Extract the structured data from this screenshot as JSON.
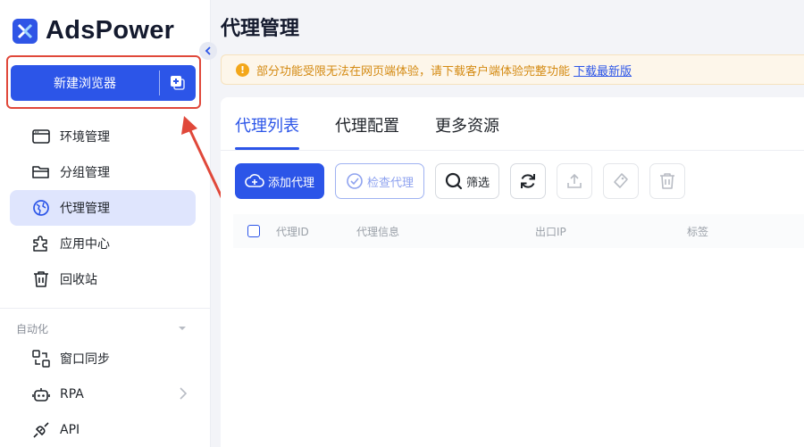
{
  "app": {
    "logo_text": "AdsPower",
    "brand_color": "#2c55e8",
    "highlight_color": "#e0483a"
  },
  "sidebar": {
    "new_browser_label": "新建浏览器",
    "items": [
      {
        "label": "环境管理",
        "icon": "window-icon"
      },
      {
        "label": "分组管理",
        "icon": "folder-icon"
      },
      {
        "label": "代理管理",
        "icon": "globe-icon",
        "active": true
      },
      {
        "label": "应用中心",
        "icon": "puzzle-icon"
      },
      {
        "label": "回收站",
        "icon": "trash-icon"
      }
    ],
    "section_automation": "自动化",
    "automation_items": [
      {
        "label": "窗口同步",
        "icon": "sync-window-icon"
      },
      {
        "label": "RPA",
        "icon": "robot-icon"
      },
      {
        "label": "API",
        "icon": "plug-icon"
      }
    ]
  },
  "main": {
    "title": "代理管理",
    "notice": {
      "text": "部分功能受限无法在网页端体验，请下载客户端体验完整功能",
      "link": "下载最新版"
    },
    "tabs": [
      {
        "label": "代理列表",
        "active": true
      },
      {
        "label": "代理配置"
      },
      {
        "label": "更多资源"
      }
    ],
    "toolbar": {
      "add_proxy": "添加代理",
      "check_proxy": "检查代理",
      "filter": "筛选"
    },
    "table": {
      "columns": [
        "代理ID",
        "代理信息",
        "出口IP",
        "标签"
      ]
    }
  }
}
